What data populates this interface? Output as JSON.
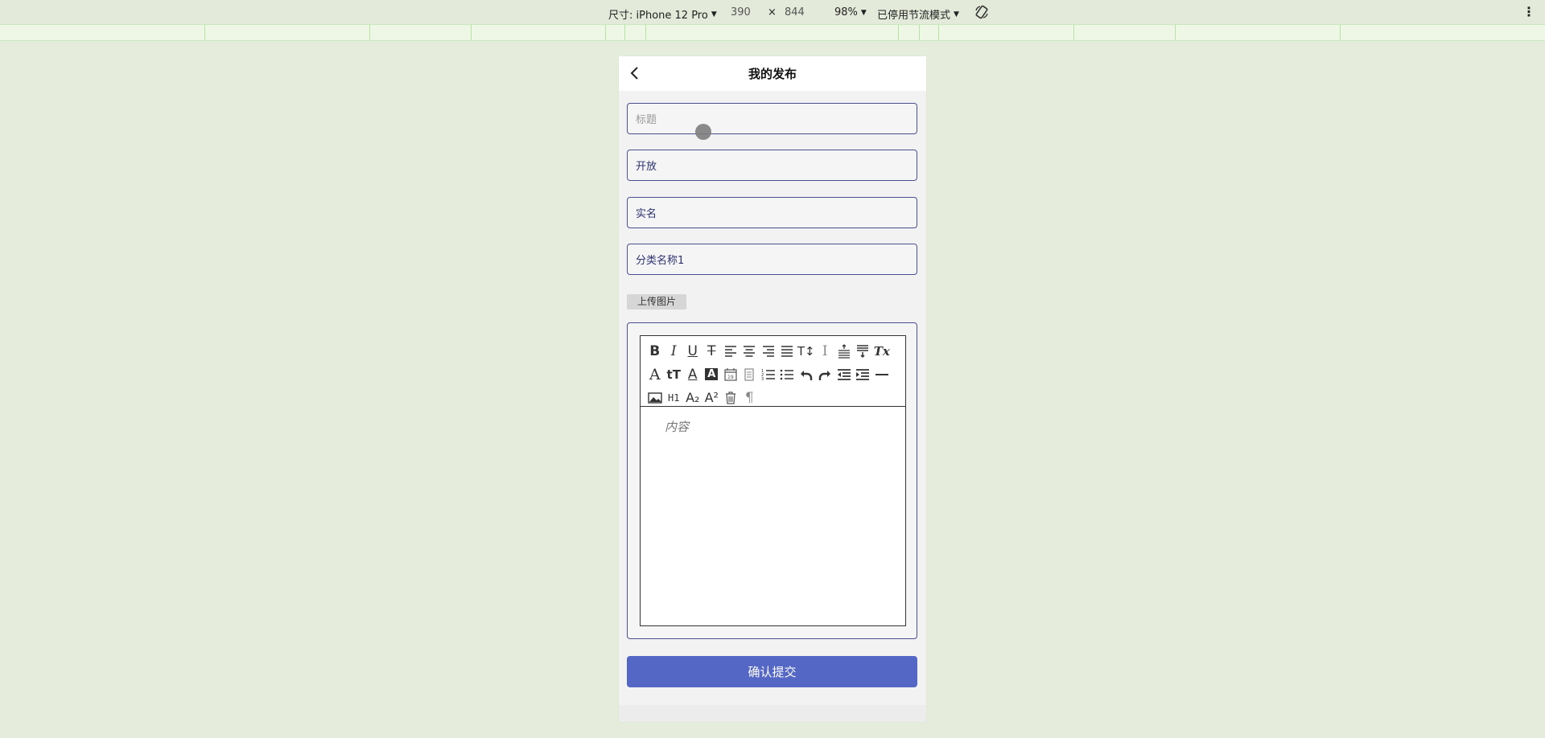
{
  "devtools": {
    "device_label": "尺寸: iPhone 12 Pro",
    "width": "390",
    "times": "×",
    "height": "844",
    "zoom": "98%",
    "throttle": "已停用节流模式"
  },
  "page": {
    "title": "我的发布"
  },
  "form": {
    "title_placeholder": "标题",
    "visibility_value": "开放",
    "identity_value": "实名",
    "category_value": "分类名称1",
    "upload_label": "上传图片",
    "content_placeholder": "内容",
    "submit_label": "确认提交"
  },
  "toolbar": {
    "row1": [
      "B",
      "I",
      "U",
      "S",
      "≡",
      "≡",
      "≡",
      "≡",
      "T↕",
      "I",
      "≡",
      "≡",
      "Tx",
      "A"
    ],
    "row2": [
      "tT",
      "A",
      "A",
      "19",
      "▥",
      "1≡",
      "•≡",
      "↶",
      "↷",
      "⇤",
      "⇥",
      "—",
      "▣",
      "H1"
    ],
    "row3": [
      "A₂",
      "A²",
      "🗑",
      "¶"
    ]
  },
  "colors": {
    "accent": "#5567c5",
    "border": "#4a4f8f",
    "background": "#e5ecdc"
  }
}
